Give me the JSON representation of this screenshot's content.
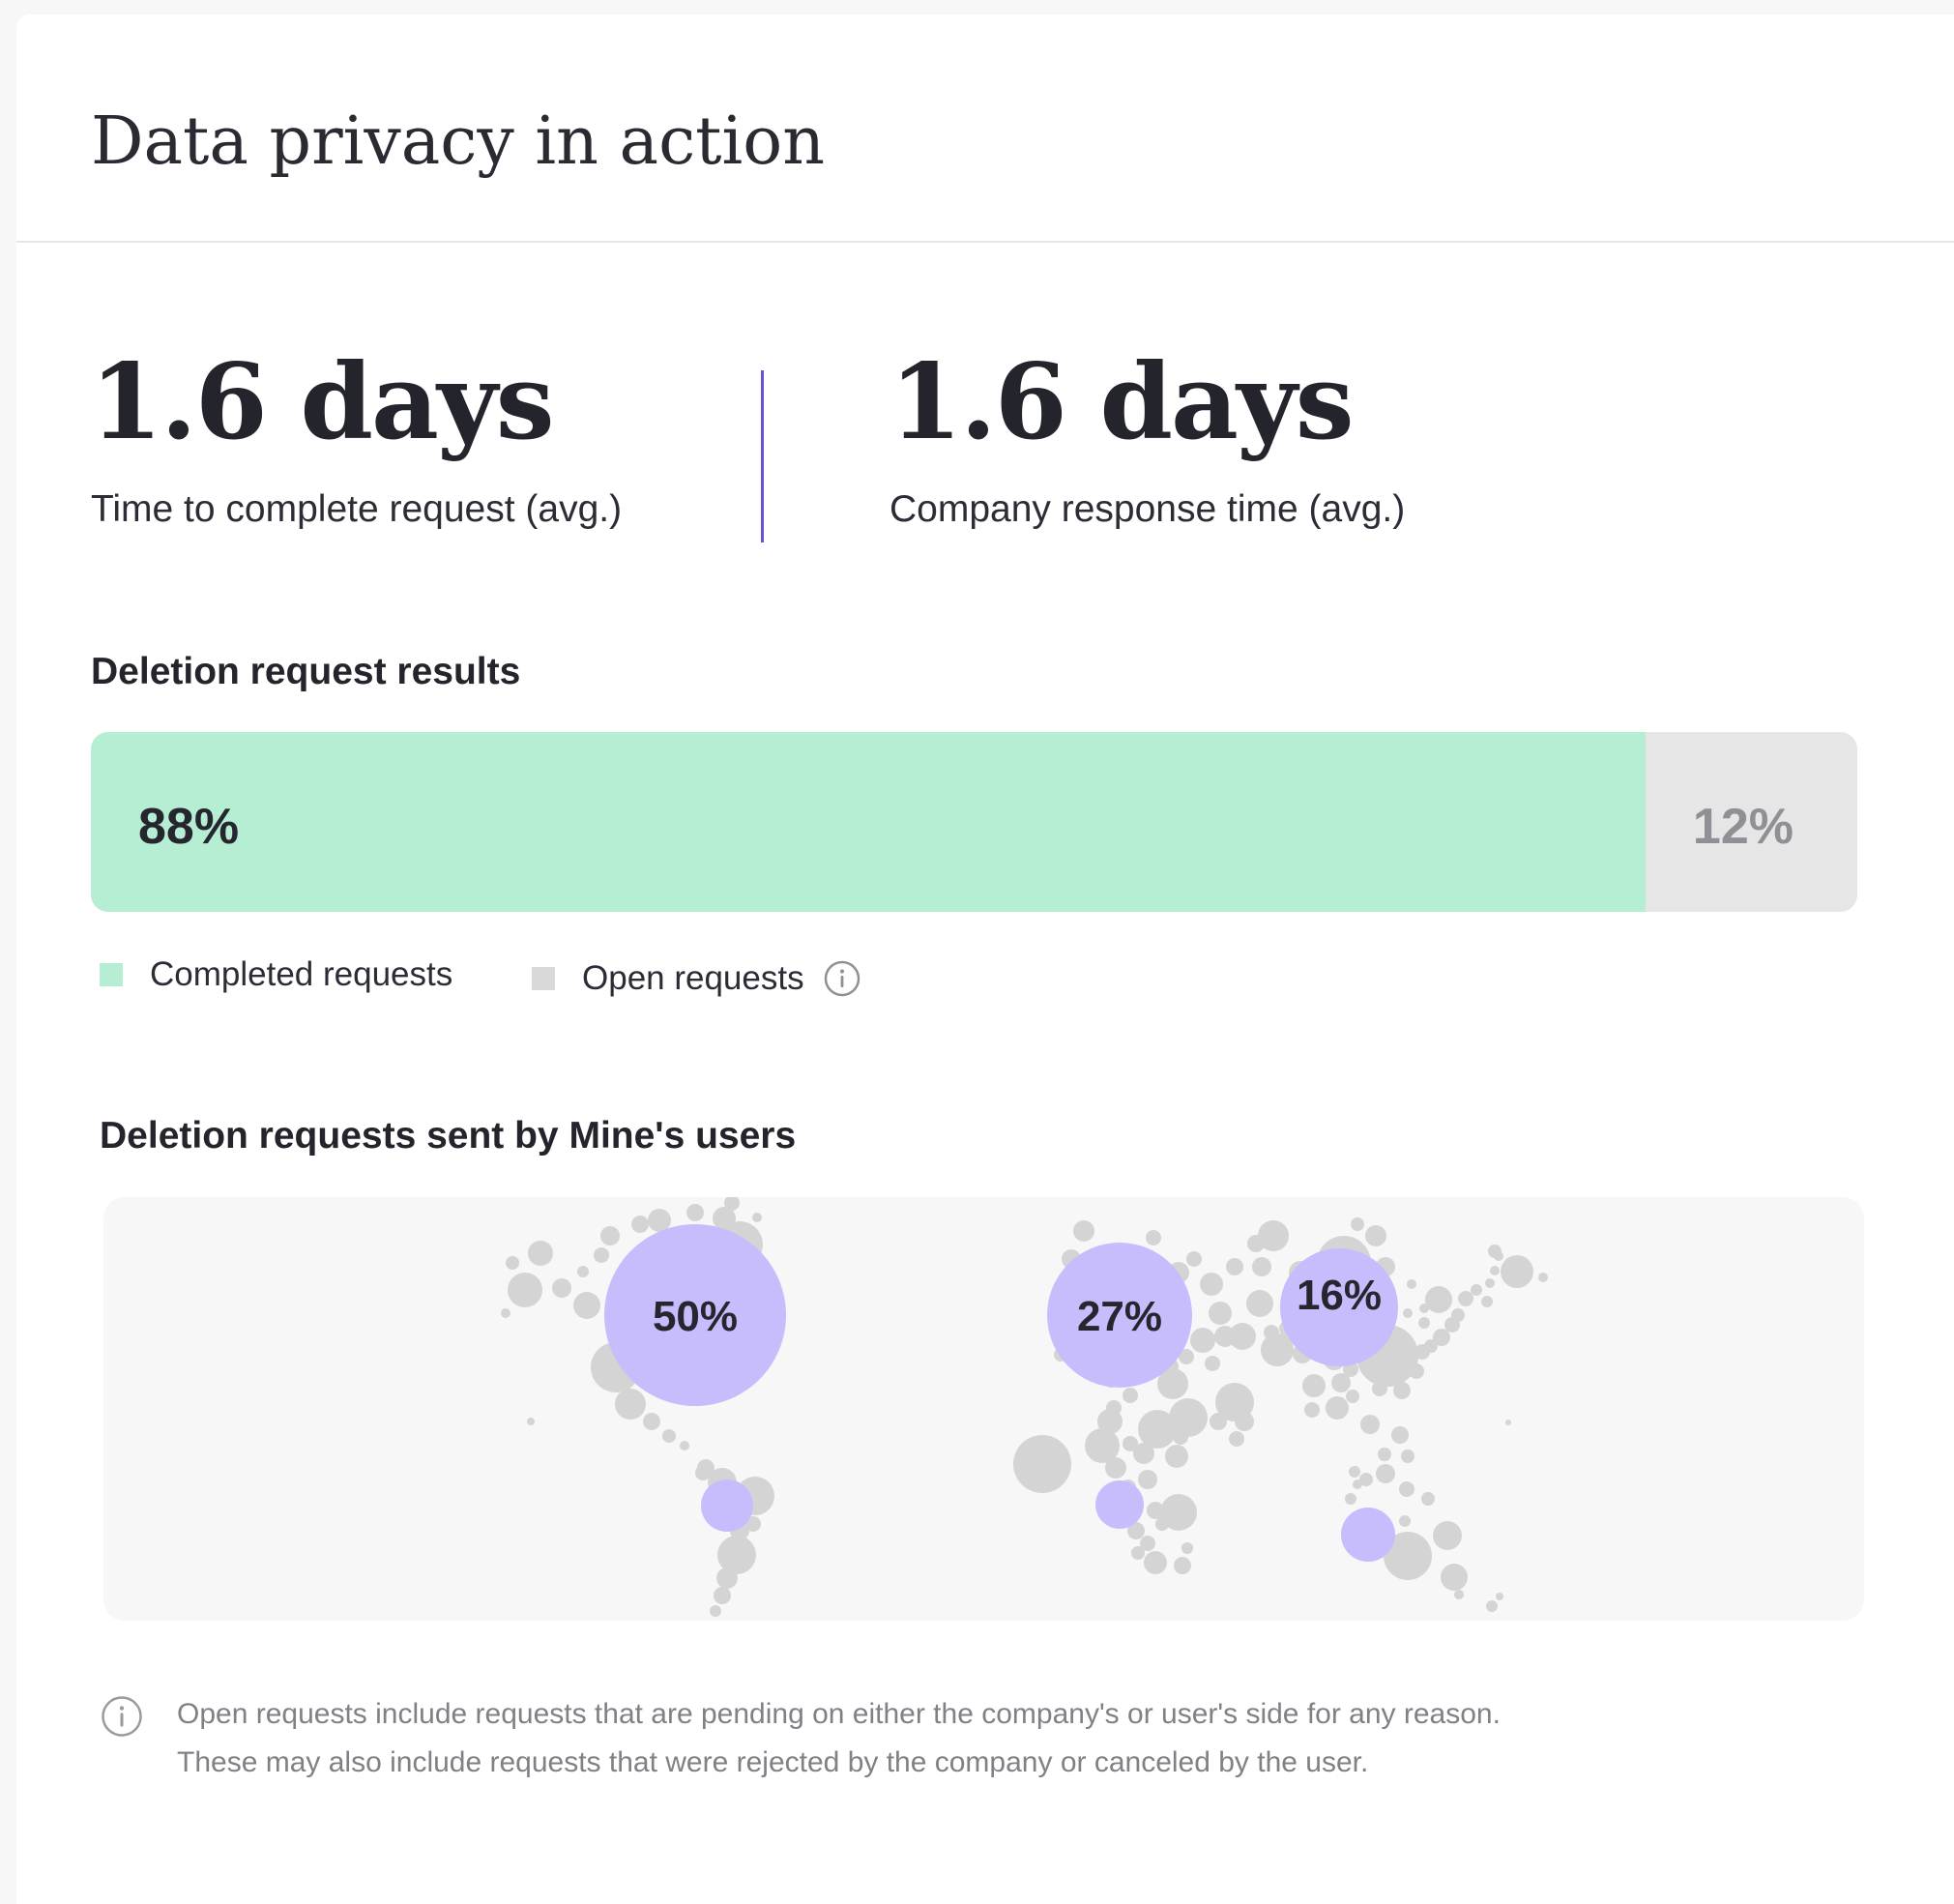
{
  "header": {
    "title": "Data privacy in action"
  },
  "stats": [
    {
      "value": "1.6 days",
      "label": "Time to complete request (avg.)"
    },
    {
      "value": "1.6 days",
      "label": "Company response time (avg.)"
    }
  ],
  "deletion_results": {
    "title": "Deletion request results",
    "completed_percent": 88,
    "open_percent": 12,
    "completed_label": "88%",
    "open_label": "12%",
    "legend": {
      "completed": "Completed requests",
      "open": "Open requests"
    },
    "colors": {
      "completed": "#b5eed2",
      "open": "#e6e6e6"
    },
    "info_icon": "info-icon"
  },
  "map_section": {
    "title": "Deletion requests sent by Mine's users",
    "regions": [
      {
        "region": "north-america",
        "label": "50%",
        "value": 50
      },
      {
        "region": "europe",
        "label": "27%",
        "value": 27
      },
      {
        "region": "asia",
        "label": "16%",
        "value": 16
      },
      {
        "region": "south-america",
        "label": "",
        "value": null
      },
      {
        "region": "africa",
        "label": "",
        "value": null
      },
      {
        "region": "oceania",
        "label": "",
        "value": null
      }
    ],
    "colors": {
      "highlight": "#c7bdfd",
      "dot": "#d4d4d4",
      "background": "#f7f7f7"
    }
  },
  "footnote": {
    "icon": "info-icon",
    "lines": [
      "Open requests include requests that are pending on either the company's or user's side for any reason.",
      "These may also include requests that were rejected by the company or canceled by the user."
    ]
  },
  "colors": {
    "accent": "#6b52d1",
    "text": "#24242d",
    "muted": "#808087"
  }
}
